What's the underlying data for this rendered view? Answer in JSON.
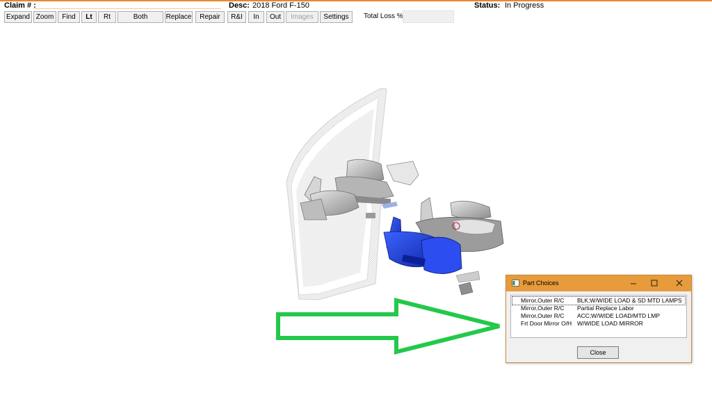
{
  "header": {
    "claim_label": "Claim # :",
    "claim_value": "",
    "desc_label": "Desc:",
    "desc_value": "2018 Ford F-150",
    "status_label": "Status:",
    "status_value": "In Progress"
  },
  "toolbar": {
    "expand": "Expand",
    "zoom": "Zoom",
    "find": "Find",
    "lt": "Lt",
    "rt": "Rt",
    "both": "Both",
    "replace": "Replace",
    "repair": "Repair",
    "ri": "R&I",
    "in": "In",
    "out": "Out",
    "images": "Images",
    "settings": "Settings",
    "total_loss_label": "Total Loss % 0",
    "total_loss_value": ""
  },
  "viewport": {
    "highlighted_part_color": "#1f3fd6",
    "arrow_color": "#22c94a"
  },
  "dialog": {
    "title": "Part Choices",
    "items": [
      {
        "part": "Mirror,Outer R/C",
        "desc": "BLK;W/WIDE LOAD & SD MTD LAMPS"
      },
      {
        "part": "Mirror,Outer R/C",
        "desc": "Partial Replace Labor"
      },
      {
        "part": "Mirror,Outer R/C",
        "desc": "ACC;W/WIDE LOAD/MTD LMP"
      },
      {
        "part": "Frt Door Mirror O/H",
        "desc": " W/WIDE LOAD MIRROR"
      }
    ],
    "close_label": "Close"
  },
  "colors": {
    "accent": "#e8872c",
    "titlebar": "#e79b3a",
    "selected_part": "#1f3fd6",
    "arrow": "#22c94a"
  }
}
